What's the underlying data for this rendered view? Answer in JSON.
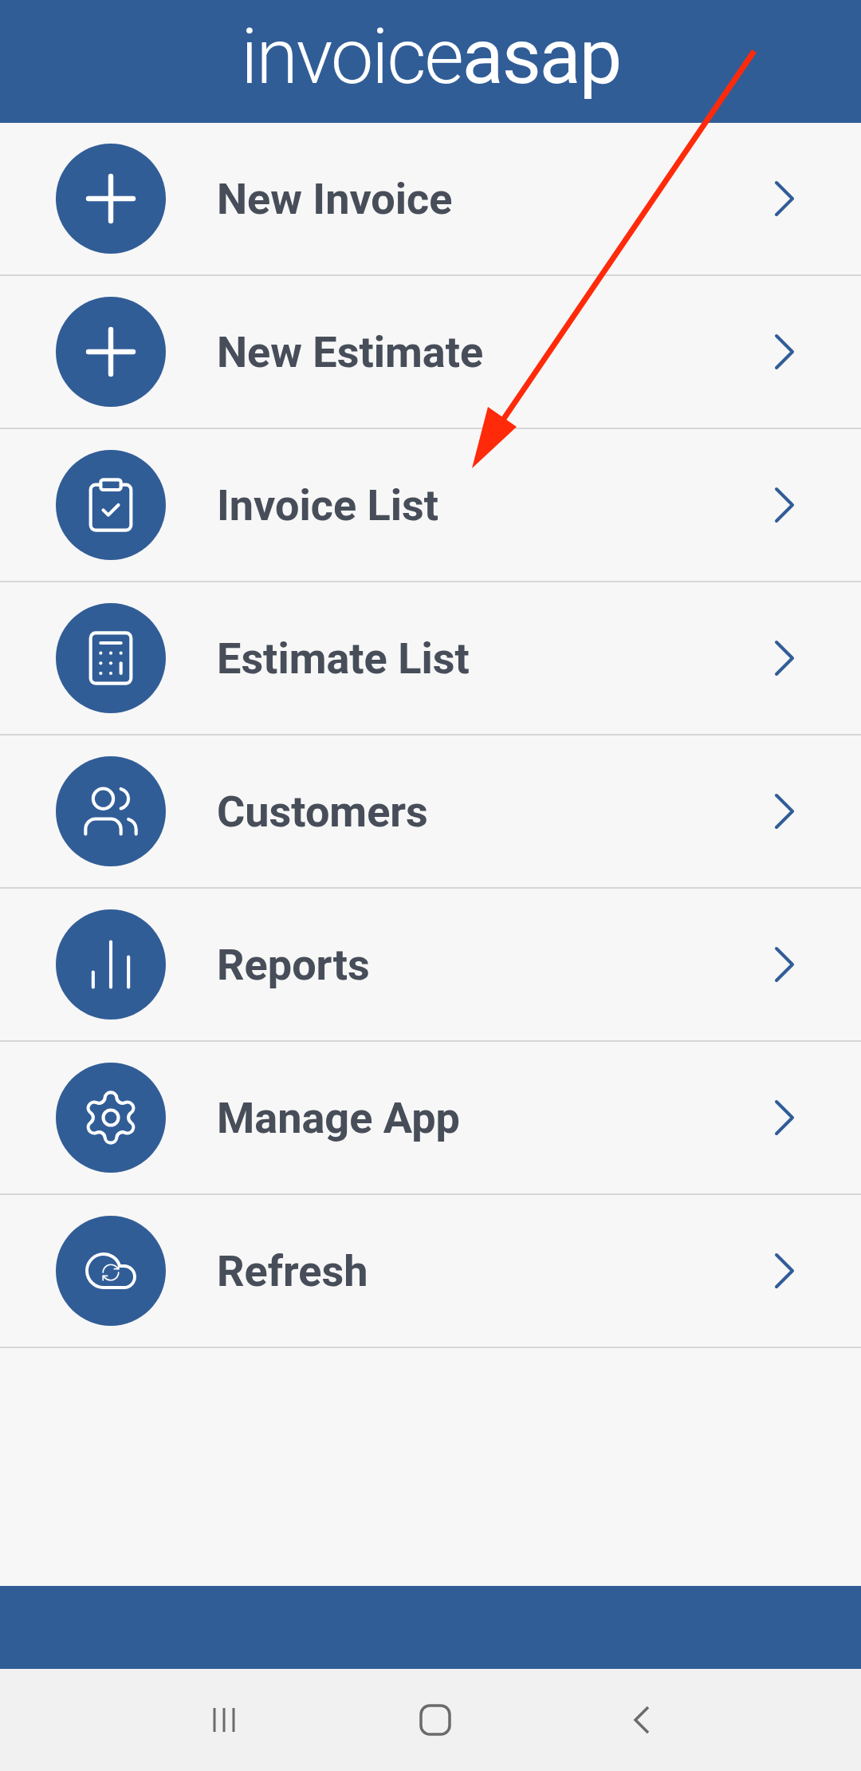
{
  "header": {
    "logo": "invoice**asap**"
  },
  "menu": [
    {
      "label": "New Invoice"
    },
    {
      "label": "New Estimate"
    },
    {
      "label": "Invoice List"
    },
    {
      "label": "Estimate List"
    },
    {
      "label": "Customers"
    },
    {
      "label": "Reports"
    },
    {
      "label": "Manage App"
    },
    {
      "label": "Refresh"
    }
  ]
}
